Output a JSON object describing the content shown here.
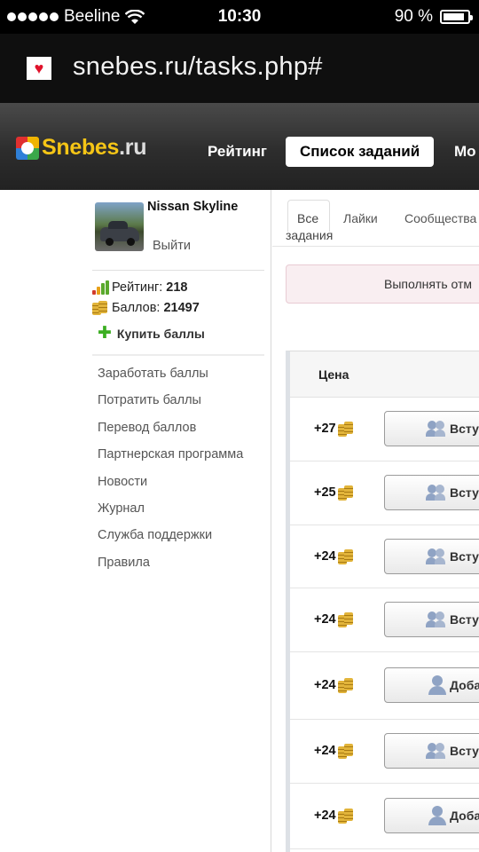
{
  "status_bar": {
    "carrier": "Beeline",
    "time": "10:30",
    "battery": "90 %",
    "battery_level": 0.9
  },
  "browser": {
    "url": "snebes.ru/tasks.php#"
  },
  "header": {
    "logo_main": "Snebes",
    "logo_suffix": ".ru",
    "nav": {
      "rating": "Рейтинг",
      "tasks": "Список заданий",
      "more": "Мо"
    }
  },
  "sidebar": {
    "username": "Nissan Skyline",
    "logout": "Выйти",
    "rating_label": "Рейтинг:",
    "rating_value": "218",
    "points_label": "Баллов:",
    "points_value": "21497",
    "buy_points": "Купить баллы",
    "menu": [
      "Заработать баллы",
      "Потратить баллы",
      "Перевод баллов",
      "Партнерская программа",
      "Новости",
      "Журнал",
      "Служба поддержки",
      "Правила"
    ]
  },
  "main": {
    "tabs": {
      "all_line1": "Все",
      "all_line2": "задания",
      "likes": "Лайки",
      "communities": "Сообщества"
    },
    "alert": "Выполнять отм",
    "table": {
      "price_header": "Цена",
      "rows": [
        {
          "price": "+27",
          "action": "Вступ",
          "icon": "group-icon"
        },
        {
          "price": "+25",
          "action": "Вступ",
          "icon": "group-icon"
        },
        {
          "price": "+24",
          "action": "Вступ",
          "icon": "group-icon"
        },
        {
          "price": "+24",
          "action": "Вступ",
          "icon": "group-icon"
        },
        {
          "price": "+24",
          "action": "Доба",
          "icon": "user-icon"
        },
        {
          "price": "+24",
          "action": "Вступ",
          "icon": "group-icon"
        },
        {
          "price": "+24",
          "action": "Доба",
          "icon": "user-icon"
        }
      ]
    }
  },
  "colors": {
    "accent_yellow": "#f5c516",
    "alert_bg": "#f9eef1",
    "plus_green": "#3cae22"
  }
}
